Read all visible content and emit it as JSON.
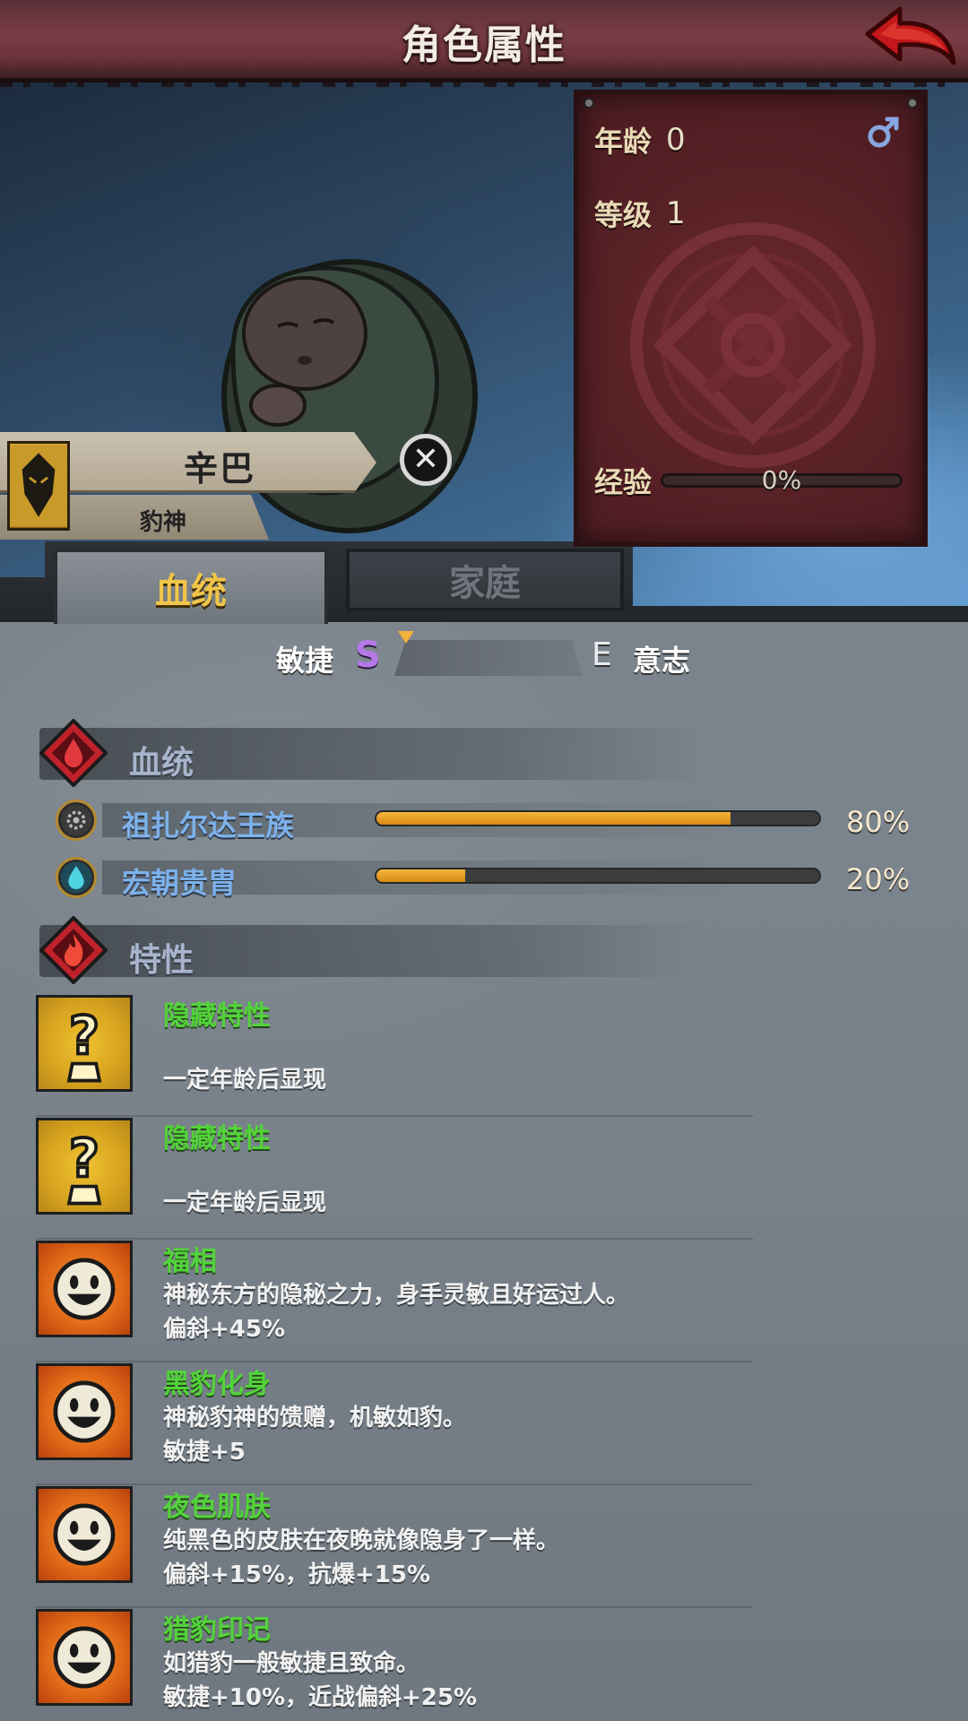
{
  "header": {
    "title": "角色属性"
  },
  "stats": {
    "age_label": "年龄",
    "age_value": "0",
    "level_label": "等级",
    "level_value": "1",
    "exp_label": "经验",
    "exp_value": "0%",
    "gender_symbol": "♂"
  },
  "character": {
    "name": "辛巴",
    "title": "豹神"
  },
  "tabs": [
    {
      "label": "血统",
      "active": true
    },
    {
      "label": "家庭",
      "active": false
    }
  ],
  "attributes": {
    "left_label": "敏捷",
    "left_grade": "S",
    "right_grade": "E",
    "right_label": "意志"
  },
  "bloodline": {
    "title": "血统",
    "items": [
      {
        "name": "祖扎尔达王族",
        "percent": "80%",
        "value": 0.8
      },
      {
        "name": "宏朝贵胄",
        "percent": "20%",
        "value": 0.2
      }
    ]
  },
  "traits_section": {
    "title": "特性"
  },
  "traits": [
    {
      "name": "隐藏特性",
      "desc": "一定年龄后显现",
      "effect": "",
      "icon": "question-icon"
    },
    {
      "name": "隐藏特性",
      "desc": "一定年龄后显现",
      "effect": "",
      "icon": "question-icon"
    },
    {
      "name": "福相",
      "desc": "神秘东方的隐秘之力，身手灵敏且好运过人。",
      "effect": "偏斜+45%",
      "icon": "smiley-icon"
    },
    {
      "name": "黑豹化身",
      "desc": "神秘豹神的馈赠，机敏如豹。",
      "effect": "敏捷+5",
      "icon": "smiley-icon"
    },
    {
      "name": "夜色肌肤",
      "desc": "纯黑色的皮肤在夜晚就像隐身了一样。",
      "effect": "偏斜+15%，抗爆+15%",
      "icon": "smiley-icon"
    },
    {
      "name": "猎豹印记",
      "desc": "如猎豹一般敏捷且致命。",
      "effect": "敏捷+10%，近战偏斜+25%",
      "icon": "smiley-icon"
    }
  ],
  "colors": {
    "header": "#7a3d45",
    "tab_active_text": "#f0c54a",
    "trait_name": "#53d33a",
    "lineage_name": "#7db1ea",
    "bar_fill": "#f5b53a"
  }
}
